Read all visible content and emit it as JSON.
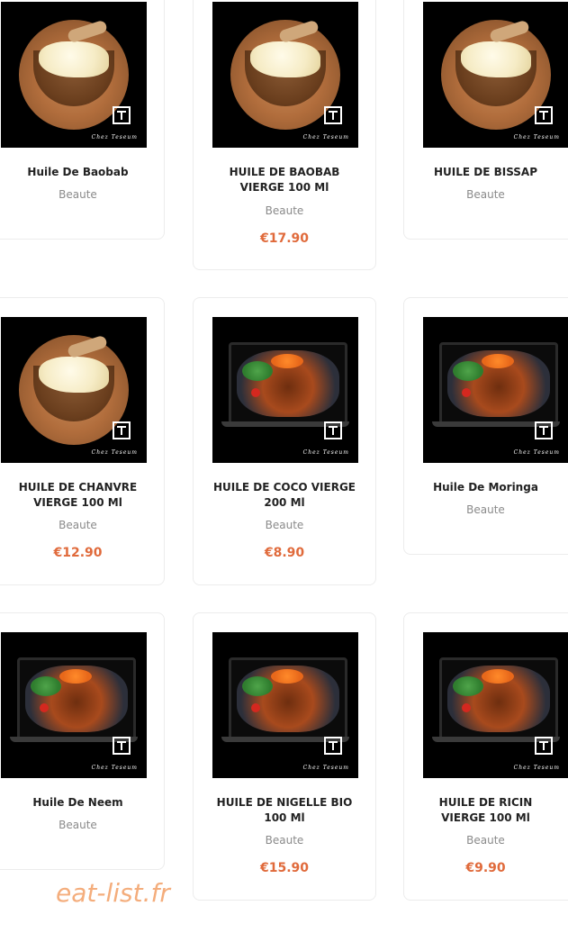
{
  "products": [
    {
      "name": "Huile De Baobab",
      "category": "Beaute",
      "price": "",
      "image": "butter"
    },
    {
      "name": "HUILE DE BAOBAB VIERGE 100 Ml",
      "category": "Beaute",
      "price": "€17.90",
      "image": "butter"
    },
    {
      "name": "HUILE DE BISSAP",
      "category": "Beaute",
      "price": "",
      "image": "butter"
    },
    {
      "name": "HUILE DE CHANVRE VIERGE 100 Ml",
      "category": "Beaute",
      "price": "€12.90",
      "image": "butter"
    },
    {
      "name": "HUILE DE COCO VIERGE 200 Ml",
      "category": "Beaute",
      "price": "€8.90",
      "image": "dish"
    },
    {
      "name": "Huile De Moringa",
      "category": "Beaute",
      "price": "",
      "image": "dish"
    },
    {
      "name": "Huile De Neem",
      "category": "Beaute",
      "price": "",
      "image": "dish"
    },
    {
      "name": "HUILE DE NIGELLE BIO 100 Ml",
      "category": "Beaute",
      "price": "€15.90",
      "image": "dish"
    },
    {
      "name": "HUILE DE RICIN VIERGE 100 Ml",
      "category": "Beaute",
      "price": "€9.90",
      "image": "dish"
    }
  ],
  "logo_text": "Chez Teseum",
  "watermark": "eat-list.fr",
  "colors": {
    "price": "#e06a3b",
    "category": "#8a8a8a",
    "watermark": "#f4ad7c"
  }
}
